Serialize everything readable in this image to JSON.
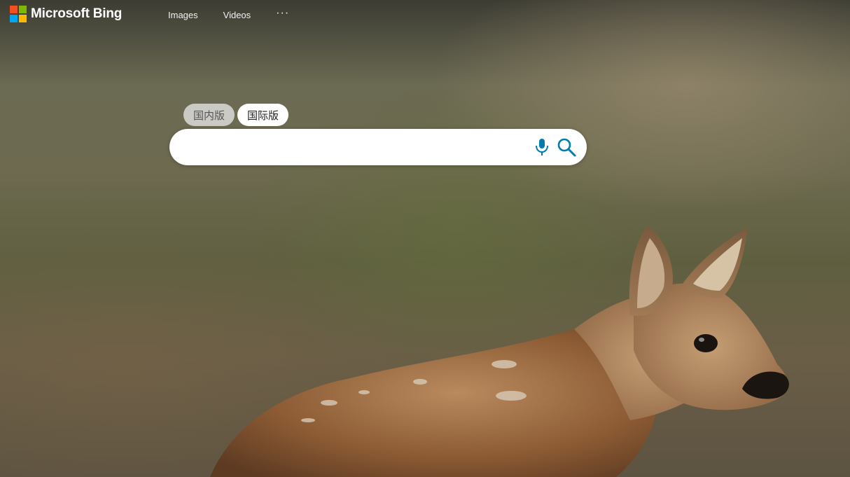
{
  "brand": {
    "name": "Microsoft Bing",
    "logo_colors": [
      "#f25022",
      "#7fba00",
      "#00a4ef",
      "#ffb900"
    ]
  },
  "nav": {
    "items": [
      {
        "label": "Images"
      },
      {
        "label": "Videos"
      }
    ],
    "more_label": "···"
  },
  "scope_tabs": [
    {
      "label": "国内版",
      "selected": false
    },
    {
      "label": "国际版",
      "selected": true
    }
  ],
  "search": {
    "value": "",
    "placeholder": "",
    "mic_icon": "microphone-icon",
    "search_icon": "magnifier-icon",
    "accent_color": "#007daa"
  },
  "background": {
    "subject": "fawn-photo"
  }
}
